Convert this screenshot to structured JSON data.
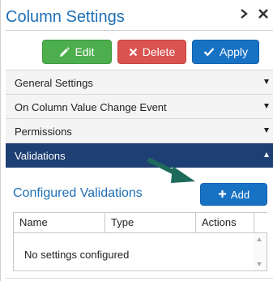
{
  "header": {
    "title": "Column Settings",
    "expand_icon": "chevron-right-icon",
    "close_icon": "close-icon"
  },
  "toolbar": {
    "edit_label": "Edit",
    "delete_label": "Delete",
    "apply_label": "Apply",
    "colors": {
      "edit": "#4cae4c",
      "delete": "#d9534f",
      "apply": "#1872c4"
    }
  },
  "sections": [
    {
      "label": "General Settings",
      "expanded": false
    },
    {
      "label": "On Column Value Change Event",
      "expanded": false
    },
    {
      "label": "Permissions",
      "expanded": false
    },
    {
      "label": "Validations",
      "expanded": true
    }
  ],
  "validations": {
    "title": "Configured Validations",
    "add_label": "Add",
    "columns": [
      "Name",
      "Type",
      "Actions"
    ],
    "empty_message": "No settings configured"
  },
  "colors": {
    "accent": "#1f6fb5",
    "active_section": "#1e3f73",
    "arrow": "#1e6b5c"
  }
}
